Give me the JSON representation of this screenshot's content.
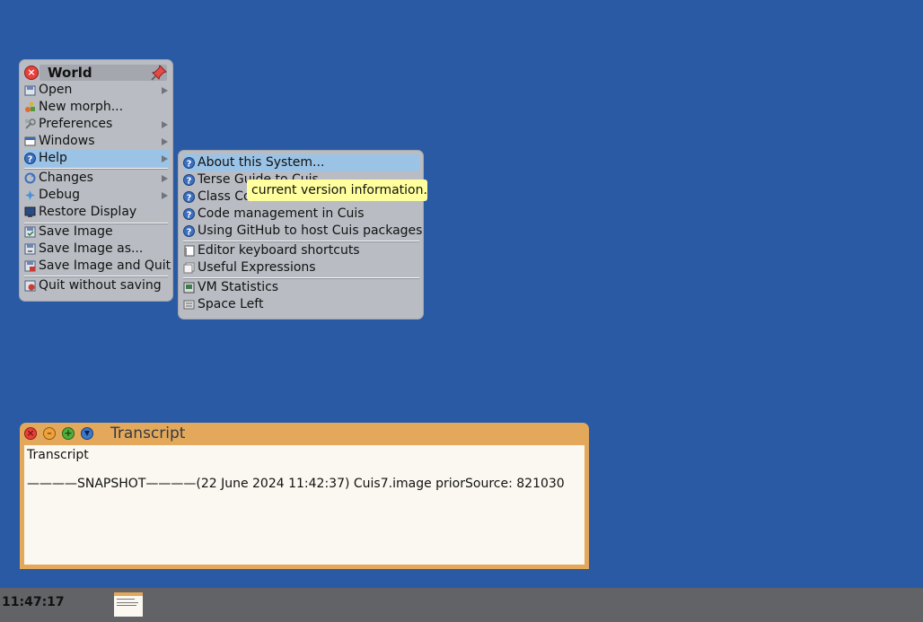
{
  "world_menu": {
    "title": "World",
    "items": [
      {
        "label": "Open",
        "icon": "open-icon",
        "submenu": true
      },
      {
        "label": "New morph...",
        "icon": "new-morph-icon",
        "submenu": false
      },
      {
        "label": "Preferences",
        "icon": "preferences-icon",
        "submenu": true
      },
      {
        "label": "Windows",
        "icon": "windows-icon",
        "submenu": true
      },
      {
        "label": "Help",
        "icon": "help-icon",
        "submenu": true,
        "highlighted": true
      },
      {
        "label": "Changes",
        "icon": "changes-icon",
        "submenu": true
      },
      {
        "label": "Debug",
        "icon": "debug-icon",
        "submenu": true
      },
      {
        "label": "Restore Display",
        "icon": "restore-display-icon",
        "submenu": false
      },
      {
        "label": "Save Image",
        "icon": "save-icon",
        "submenu": false
      },
      {
        "label": "Save Image as...",
        "icon": "save-as-icon",
        "submenu": false
      },
      {
        "label": "Save Image and Quit",
        "icon": "save-quit-icon",
        "submenu": false
      },
      {
        "label": "Quit without saving",
        "icon": "quit-icon",
        "submenu": false
      }
    ]
  },
  "help_menu": {
    "items": [
      {
        "label": "About this System...",
        "icon": "help-icon",
        "highlighted": true
      },
      {
        "label": "Terse Guide to Cuis",
        "icon": "help-icon"
      },
      {
        "label": "Class Comment Browser",
        "icon": "help-icon"
      },
      {
        "label": "Code management in Cuis",
        "icon": "help-icon"
      },
      {
        "label": "Using GitHub to host Cuis packages",
        "icon": "help-icon"
      },
      {
        "label": "Editor keyboard shortcuts",
        "icon": "keyboard-icon"
      },
      {
        "label": "Useful Expressions",
        "icon": "expressions-icon"
      },
      {
        "label": "VM Statistics",
        "icon": "statistics-icon"
      },
      {
        "label": "Space Left",
        "icon": "space-icon"
      }
    ]
  },
  "tooltip": {
    "text": "current version information."
  },
  "transcript": {
    "title": "Transcript",
    "lines": [
      "Transcript",
      "",
      "————SNAPSHOT————(22 June 2024 11:42:37) Cuis7.image priorSource: 821030"
    ]
  },
  "taskbar": {
    "clock": "11:47:17"
  },
  "colors": {
    "desktop": "#2b5aa4",
    "menu_bg": "#b9bdc3",
    "highlight": "#9bc3e6",
    "window_frame": "#e4a85a",
    "tooltip": "#ffff9e",
    "taskbar": "#626366"
  }
}
